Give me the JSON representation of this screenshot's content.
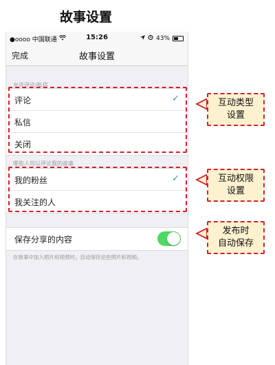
{
  "page_heading": "故事设置",
  "status_bar": {
    "carrier": "●oooo 中国联通",
    "time": "15:26",
    "battery": "43%"
  },
  "nav_bar": {
    "done_label": "完成",
    "title": "故事设置"
  },
  "interaction_section": {
    "header": "允许评论/私信",
    "options": [
      {
        "label": "评论",
        "selected": true
      },
      {
        "label": "私信",
        "selected": false
      },
      {
        "label": "关闭",
        "selected": false
      }
    ]
  },
  "audience_section": {
    "header": "哪些人可以评论我的故事",
    "options": [
      {
        "label": "我的粉丝",
        "selected": true
      },
      {
        "label": "我关注的人",
        "selected": false
      }
    ]
  },
  "save_section": {
    "label": "保存分享的内容",
    "enabled": true,
    "footnote": "在故事中加入照片和视频时，自动保存这些照片和视频。"
  },
  "annotations": {
    "type_setting": [
      "互动类型",
      "设置"
    ],
    "permission_setting": [
      "互动权限",
      "设置"
    ],
    "auto_save": [
      "发布时",
      "自动保存"
    ]
  },
  "colors": {
    "accent_check": "#3b8be0",
    "toggle_on": "#4cd964",
    "annotation_border": "#d0202a",
    "annotation_fill": "#fdf1cf"
  },
  "icons": {
    "check": "checkmark-icon",
    "wifi": "wifi-icon",
    "alarm": "alarm-icon",
    "battery": "battery-icon"
  }
}
